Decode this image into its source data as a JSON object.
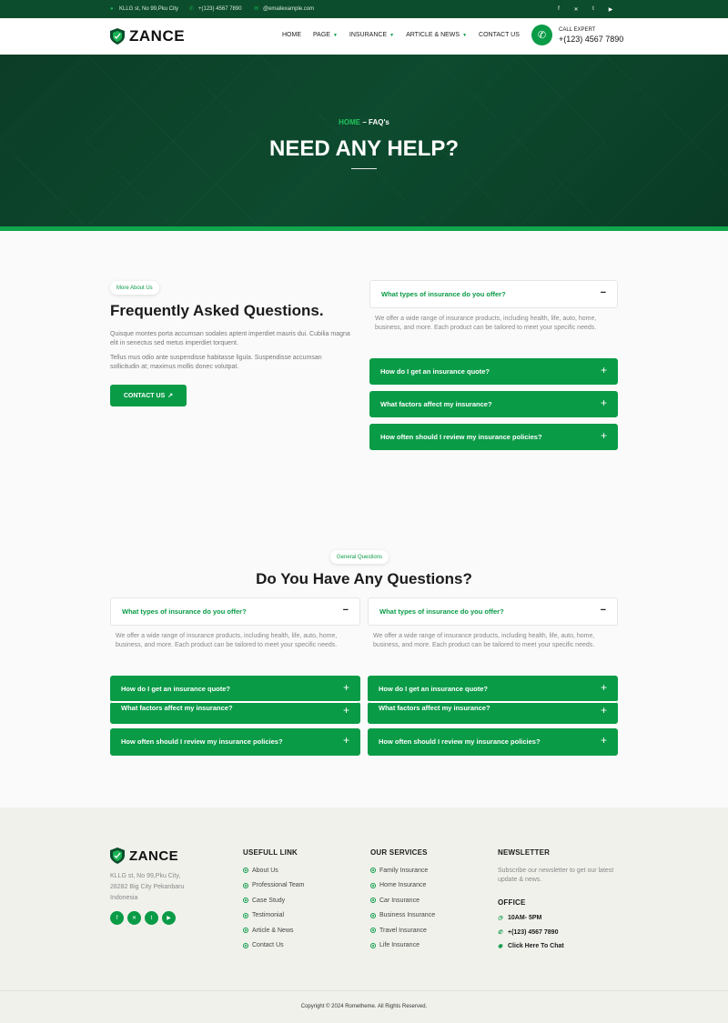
{
  "topbar": {
    "address": "KLLG st, No 99,Pku City",
    "phone": "+(123) 4567 7890",
    "email": "@emailexample.com"
  },
  "nav": {
    "logo": "ZANCE",
    "menu": [
      "HOME",
      "PAGE",
      "INSURANCE",
      "ARTICLE & NEWS",
      "CONTACT US"
    ],
    "call_label": "CALL EXPERT",
    "call_number": "+(123) 4567 7890"
  },
  "hero": {
    "breadcrumb_home": "HOME",
    "breadcrumb_sep": " – ",
    "breadcrumb_current": "FAQ's",
    "title": "NEED ANY HELP?"
  },
  "about": {
    "pill": "More About Us",
    "title": "Frequently Asked Questions.",
    "para1": "Quisque montes porta accumsan sodales aptent imperdiet mauris dui. Cubilia magna elit in senectus sed metus imperdiet torquent.",
    "para2": "Tellus mus odio ante suspendisse habitasse ligula. Suspendisse accumsan sollicitudin at; maximus mollis donec volutpat.",
    "cta": "CONTACT US",
    "cta_icon": "↗"
  },
  "faq": {
    "open_question": "What types of insurance do you offer?",
    "open_answer": "We offer a wide range of insurance products, including health, life, auto, home, business, and more. Each product can be tailored to meet your specific needs.",
    "q2": "How do I get an insurance quote?",
    "q3": "What factors affect my insurance?",
    "q4": "How often should I review my insurance policies?",
    "minus": "−",
    "plus": "+"
  },
  "general": {
    "pill": "General Questions",
    "title": "Do You Have Any Questions?"
  },
  "footer": {
    "logo": "ZANCE",
    "address_l1": "KLLG st, No 99,Pku City,",
    "address_l2": "28282 Big City Pekanbaru",
    "address_l3": "Indonesia",
    "links_title": "USEFULL LINK",
    "links": [
      "About Us",
      "Professional Team",
      "Case Study",
      "Testimonial",
      "Article & News",
      "Contact Us"
    ],
    "services_title": "OUR SERVICES",
    "services": [
      "Family Insurance",
      "Home Insurance",
      "Car Insurance",
      "Business Insurance",
      "Travel Insurance",
      "Life Insurance"
    ],
    "newsletter_title": "NEWSLETTER",
    "newsletter_text": "Subscribe our newsletter to get our latest update & news.",
    "office_title": "OFFICE",
    "office_hours": "10AM- 5PM",
    "office_phone": "+(123) 4567 7890",
    "office_chat": "Click Here To Chat",
    "copyright": "Copyright © 2024 Rometheme. All Rights Reserved."
  },
  "colors": {
    "brand_green": "#0a9b47",
    "dark_green": "#0b4d2c"
  }
}
